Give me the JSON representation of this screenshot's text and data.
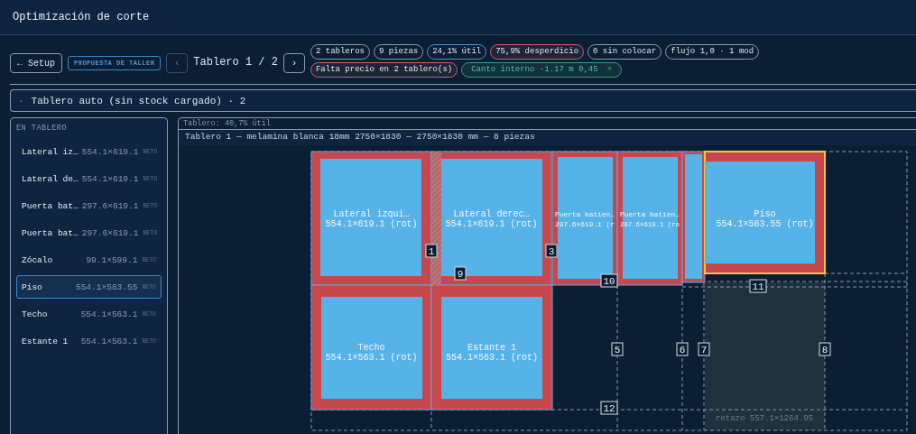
{
  "window": {
    "title": "Optimización de corte"
  },
  "toolbar": {
    "back_button": "← Setup",
    "proposal_badge": "PROPUESTA DE TALLER",
    "prev_button": "‹",
    "board_counter": "Tablero 1 / 2",
    "next_button": "›"
  },
  "chips": [
    {
      "text": "2 tableros",
      "kind": "neutral"
    },
    {
      "text": "9 piezas",
      "kind": "neutral"
    },
    {
      "text": "24,1% útil",
      "kind": "info"
    },
    {
      "text": "75,9% desperdicio",
      "kind": "danger"
    },
    {
      "text": "0 sin colocar",
      "kind": "neutral"
    },
    {
      "text": "flujo 1,0 · 1 mod",
      "kind": "neutral"
    },
    {
      "text": "Falta precio en 2 tablero(s)",
      "kind": "danger"
    },
    {
      "text": "Canto interno -1.17 m 0,45",
      "kind": "success",
      "close": "×"
    }
  ],
  "group_header": {
    "bullet": "·",
    "title": "Tablero auto (sin stock cargado) · 2"
  },
  "sidebar": {
    "heading": "EN TABLERO",
    "items": [
      {
        "name": "Lateral iz…",
        "dims": "554.1×619.1",
        "tag": "NETO",
        "selected": false
      },
      {
        "name": "Lateral de…",
        "dims": "554.1×619.1",
        "tag": "NETO",
        "selected": false
      },
      {
        "name": "Puerta bat…",
        "dims": "297.6×619.1",
        "tag": "NETO",
        "selected": false
      },
      {
        "name": "Puerta bat…",
        "dims": "297.6×619.1",
        "tag": "NETO",
        "selected": false
      },
      {
        "name": "Zócalo",
        "dims": "99.1×599.1",
        "tag": "NETO",
        "selected": false
      },
      {
        "name": "Piso",
        "dims": "554.1×563.55",
        "tag": "NETO",
        "selected": true
      },
      {
        "name": "Techo",
        "dims": "554.1×563.1",
        "tag": "NETO",
        "selected": false
      },
      {
        "name": "Estante 1",
        "dims": "554.1×563.1",
        "tag": "NETO",
        "selected": false
      }
    ]
  },
  "board": {
    "usage_label": "Tablero: 40,7% útil",
    "title": "Tablero 1 — melamina blanca 18mm 2750×1830 — 2750×1830 mm — 8 piezas",
    "pieces": [
      {
        "name": "Lateral izqui…",
        "dims": "554.1×619.1 (rot)",
        "selected": false
      },
      {
        "name": "Lateral derec…",
        "dims": "554.1×619.1 (rot)",
        "selected": false
      },
      {
        "name": "Puerta batien…",
        "dims": "297.6×619.1 (r",
        "selected": false
      },
      {
        "name": "Puerta batien…",
        "dims": "297.6×619.1 (ro",
        "selected": false
      },
      {
        "selected": false
      },
      {
        "name": "Piso",
        "dims": "554.1×563.55 (rot)",
        "selected": true
      },
      {
        "name": "Techo",
        "dims": "554.1×563.1 (rot)",
        "selected": false
      },
      {
        "name": "Estante 1",
        "dims": "554.1×563.1 (rot)",
        "selected": false
      }
    ],
    "cuts": [
      "1",
      "3",
      "9",
      "10",
      "11",
      "5",
      "6",
      "7",
      "8",
      "12"
    ],
    "offcut": "retazo 557.1×1264.95"
  }
}
